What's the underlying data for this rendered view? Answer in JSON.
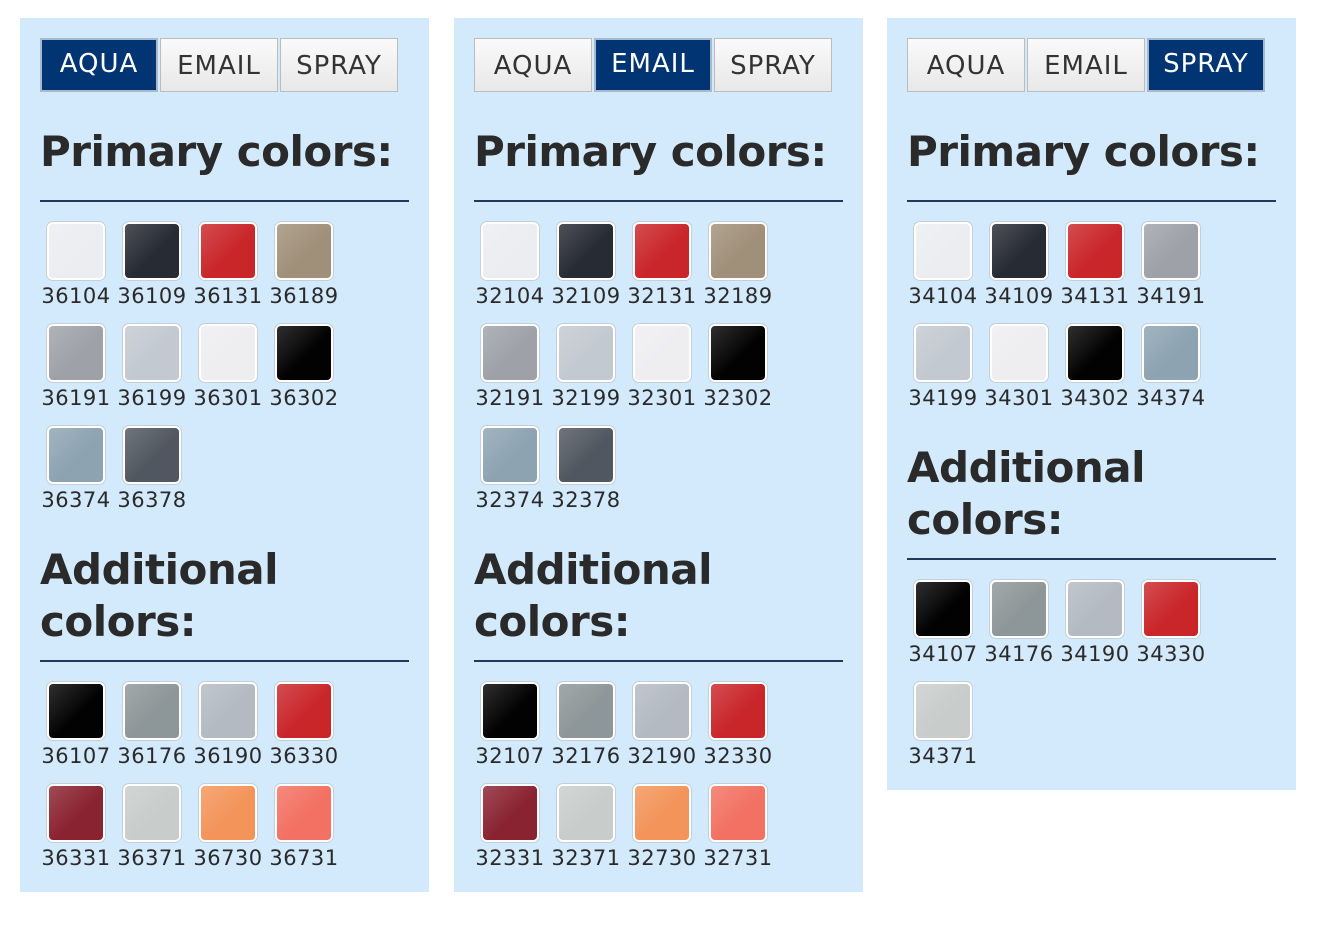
{
  "tabs": [
    "AQUA",
    "EMAIL",
    "SPRAY"
  ],
  "headings": {
    "primary": "Primary colors:",
    "additional_line1": "Additional",
    "additional_line2": "colors:"
  },
  "colors": {
    "white": "#ecedf0",
    "anthracite": "#272b33",
    "red": "#c9262a",
    "beige": "#a09079",
    "silver_dark": "#9ea2a8",
    "silver_light": "#c3c9d0",
    "white2": "#eeeef1",
    "black": "#020202",
    "blue_grey": "#8da3b2",
    "graphite": "#515760",
    "grey": "#8d9698",
    "silver_mid": "#b4bac2",
    "wine": "#8a2331",
    "light_grey": "#c8cdcc",
    "orange": "#f3945a",
    "salmon": "#f27162"
  },
  "panels": [
    {
      "active_tab": "AQUA",
      "primary": [
        {
          "code": "36104",
          "color": "white"
        },
        {
          "code": "36109",
          "color": "anthracite"
        },
        {
          "code": "36131",
          "color": "red"
        },
        {
          "code": "36189",
          "color": "beige"
        },
        {
          "code": "36191",
          "color": "silver_dark",
          "metal": true
        },
        {
          "code": "36199",
          "color": "silver_light",
          "metal": true
        },
        {
          "code": "36301",
          "color": "white2"
        },
        {
          "code": "36302",
          "color": "black"
        },
        {
          "code": "36374",
          "color": "blue_grey"
        },
        {
          "code": "36378",
          "color": "graphite"
        }
      ],
      "additional": [
        {
          "code": "36107",
          "color": "black"
        },
        {
          "code": "36176",
          "color": "grey"
        },
        {
          "code": "36190",
          "color": "silver_mid",
          "metal": true
        },
        {
          "code": "36330",
          "color": "red"
        },
        {
          "code": "36331",
          "color": "wine"
        },
        {
          "code": "36371",
          "color": "light_grey"
        },
        {
          "code": "36730",
          "color": "orange"
        },
        {
          "code": "36731",
          "color": "salmon"
        }
      ]
    },
    {
      "active_tab": "EMAIL",
      "primary": [
        {
          "code": "32104",
          "color": "white"
        },
        {
          "code": "32109",
          "color": "anthracite"
        },
        {
          "code": "32131",
          "color": "red"
        },
        {
          "code": "32189",
          "color": "beige"
        },
        {
          "code": "32191",
          "color": "silver_dark",
          "metal": true
        },
        {
          "code": "32199",
          "color": "silver_light",
          "metal": true
        },
        {
          "code": "32301",
          "color": "white2"
        },
        {
          "code": "32302",
          "color": "black"
        },
        {
          "code": "32374",
          "color": "blue_grey"
        },
        {
          "code": "32378",
          "color": "graphite"
        }
      ],
      "additional": [
        {
          "code": "32107",
          "color": "black"
        },
        {
          "code": "32176",
          "color": "grey"
        },
        {
          "code": "32190",
          "color": "silver_mid",
          "metal": true
        },
        {
          "code": "32330",
          "color": "red"
        },
        {
          "code": "32331",
          "color": "wine"
        },
        {
          "code": "32371",
          "color": "light_grey"
        },
        {
          "code": "32730",
          "color": "orange"
        },
        {
          "code": "32731",
          "color": "salmon"
        }
      ]
    },
    {
      "active_tab": "SPRAY",
      "primary": [
        {
          "code": "34104",
          "color": "white"
        },
        {
          "code": "34109",
          "color": "anthracite"
        },
        {
          "code": "34131",
          "color": "red"
        },
        {
          "code": "34191",
          "color": "silver_dark",
          "metal": true
        },
        {
          "code": "34199",
          "color": "silver_light",
          "metal": true
        },
        {
          "code": "34301",
          "color": "white2"
        },
        {
          "code": "34302",
          "color": "black"
        },
        {
          "code": "34374",
          "color": "blue_grey"
        }
      ],
      "additional": [
        {
          "code": "34107",
          "color": "black"
        },
        {
          "code": "34176",
          "color": "grey"
        },
        {
          "code": "34190",
          "color": "silver_mid",
          "metal": true
        },
        {
          "code": "34330",
          "color": "red"
        },
        {
          "code": "34371",
          "color": "light_grey"
        }
      ]
    }
  ]
}
